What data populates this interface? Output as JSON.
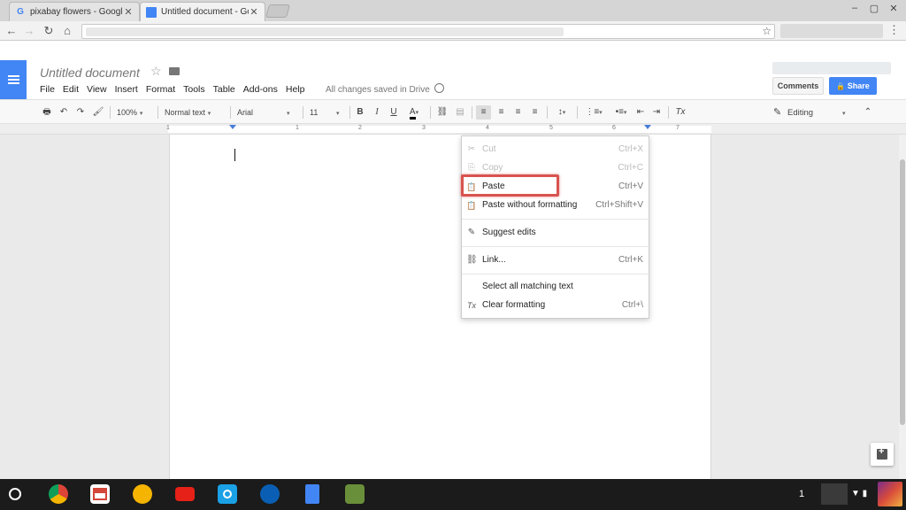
{
  "browser": {
    "tabs": [
      {
        "title": "pixabay flowers - Google",
        "icon": "google-g-icon"
      },
      {
        "title": "Untitled document - Goo",
        "icon": "docs-icon"
      }
    ],
    "close_glyph": "✕",
    "window_controls": {
      "minimize": "–",
      "maximize": "▢",
      "close": "✕"
    },
    "nav": {
      "back": "←",
      "forward": "→",
      "reload": "↻",
      "home": "⌂",
      "star": "☆",
      "menu": "⋮"
    }
  },
  "docs": {
    "title": "Untitled document",
    "star_glyph": "☆",
    "menu": [
      "File",
      "Edit",
      "View",
      "Insert",
      "Format",
      "Tools",
      "Table",
      "Add-ons",
      "Help"
    ],
    "saved_status": "All changes saved in Drive",
    "comments_label": "Comments",
    "share_label": "Share",
    "share_lock_glyph": "🔒"
  },
  "toolbar": {
    "print": "🖶",
    "undo": "↶",
    "redo": "↷",
    "paint": "🖌",
    "zoom": "100%",
    "style": "Normal text",
    "font": "Arial",
    "size": "11",
    "bold": "B",
    "italic": "I",
    "underline": "U",
    "text_color": "A",
    "link": "⛓",
    "comment": "▤",
    "align_left": "≡",
    "align_center": "≡",
    "align_right": "≡",
    "align_justify": "≡",
    "line_spacing": "↕",
    "numbered_list": "⋮≡",
    "bulleted_list": "•≡",
    "outdent": "⇤",
    "indent": "⇥",
    "clear_format": "Tx",
    "mode_label": "Editing",
    "mode_pencil": "✎",
    "collapse": "⌃",
    "caret": "▾"
  },
  "ruler": {
    "ticks": [
      "1",
      "1",
      "2",
      "3",
      "4",
      "5",
      "6",
      "7"
    ]
  },
  "context_menu": {
    "items": [
      {
        "label": "Cut",
        "shortcut": "Ctrl+X",
        "icon": "✂",
        "disabled": true
      },
      {
        "label": "Copy",
        "shortcut": "Ctrl+C",
        "icon": "⎘",
        "disabled": true
      },
      {
        "label": "Paste",
        "shortcut": "Ctrl+V",
        "icon": "📋",
        "disabled": false
      },
      {
        "label": "Paste without formatting",
        "shortcut": "Ctrl+Shift+V",
        "icon": "📋",
        "disabled": false
      },
      {
        "label": "Suggest edits",
        "shortcut": "",
        "icon": "✎",
        "disabled": false
      },
      {
        "label": "Link...",
        "shortcut": "Ctrl+K",
        "icon": "⛓",
        "disabled": false
      },
      {
        "label": "Select all matching text",
        "shortcut": "",
        "icon": "",
        "disabled": false
      },
      {
        "label": "Clear formatting",
        "shortcut": "Ctrl+\\",
        "icon": "Tx",
        "disabled": false
      }
    ]
  },
  "shelf": {
    "launcher": "",
    "apps": [
      {
        "name": "chrome",
        "color": "#db4437"
      },
      {
        "name": "gmail",
        "color": "#ffffff"
      },
      {
        "name": "play-movies",
        "color": "#f4b400"
      },
      {
        "name": "youtube",
        "color": "#e62117"
      },
      {
        "name": "camera",
        "color": "#1aa1e6"
      },
      {
        "name": "onedrive",
        "color": "#0a5fb4"
      },
      {
        "name": "docs",
        "color": "#4285f4"
      },
      {
        "name": "android-app",
        "color": "#6a8f3a"
      }
    ],
    "notification_count": "1",
    "status_glyphs": "▼ ▮"
  }
}
